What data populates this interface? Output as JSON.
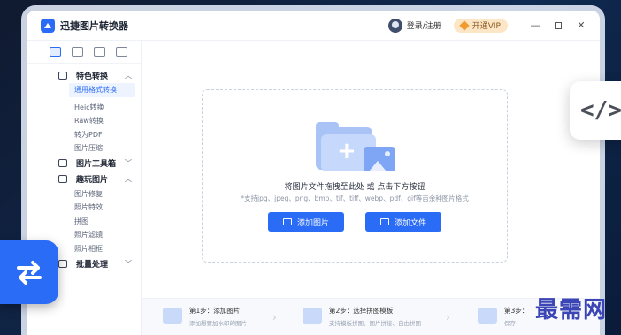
{
  "app": {
    "title": "迅捷图片转换器"
  },
  "titlebar": {
    "login_label": "登录/注册",
    "vip_label": "开通VIP",
    "minimize": "—",
    "close": "✕"
  },
  "sidebar": {
    "groups": [
      {
        "label": "特色转换",
        "items": [
          "通用格式转换",
          "Heic转换",
          "Raw转换",
          "转为PDF",
          "图片压缩"
        ]
      },
      {
        "label": "图片工具箱",
        "items": []
      },
      {
        "label": "趣玩图片",
        "items": [
          "图片修复",
          "照片特效",
          "拼图",
          "照片滤镜",
          "照片相框"
        ]
      },
      {
        "label": "批量处理",
        "items": []
      }
    ]
  },
  "main": {
    "drop_text": "将图片文件拖拽至此处 或 点击下方按钮",
    "drop_hint": "*支持jpg、jpeg、png、bmp、tif、tiff、webp、pdf、gif等百余种图片格式",
    "add_image_label": "添加图片",
    "add_file_label": "添加文件"
  },
  "steps": [
    {
      "title": "第1步：添加图片",
      "desc": "添加想要加水印的图片"
    },
    {
      "title": "第2步：选择拼图模板",
      "desc": "支持模板拼图、图片拼接、自由拼图"
    },
    {
      "title": "第3步：",
      "desc": "保存"
    }
  ],
  "overlay": {
    "code_symbol": "</>",
    "watermark": "最需网"
  },
  "colors": {
    "accent": "#2b6cf6",
    "vip_bg": "#fde6c6",
    "watermark": "#3b45b5"
  }
}
